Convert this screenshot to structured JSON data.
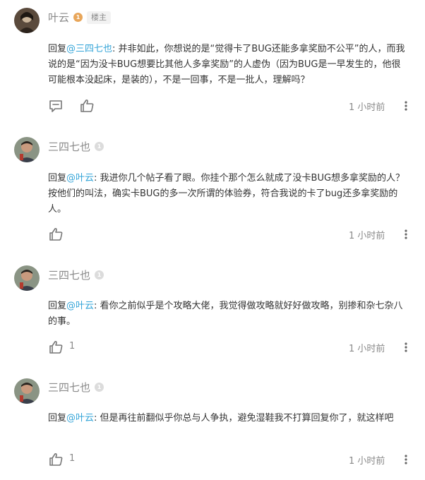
{
  "comments": [
    {
      "user": "叶云",
      "level_glyph": "1",
      "badge": "楼主",
      "reply_prefix": "回复",
      "reply_to": "@三四七也",
      "text": ": 并非如此，你想说的是“觉得卡了BUG还能多拿奖励不公平”的人，而我说的是“因为没卡BUG想要比其他人多拿奖励”的人虚伪（因为BUG是一早发生的，他很可能根本没起床，是装的），不是一回事，不是一批人，理解吗？",
      "likes": "",
      "time": "1 小时前",
      "icons": [
        "comment-icon",
        "thumbs-up-icon",
        "more-icon"
      ]
    },
    {
      "user": "三四七也",
      "level_glyph": "1",
      "reply_prefix": "回复",
      "reply_to": "@叶云",
      "text": ": 我进你几个帖子看了眼。你挂个那个怎么就成了没卡BUG想多拿奖励的人？按他们的叫法，确实卡BUG的多一次所谓的体验券，符合我说的卡了bug还多拿奖励的人。",
      "likes": "",
      "time": "1 小时前",
      "icons": [
        "thumbs-up-icon",
        "more-icon"
      ]
    },
    {
      "user": "三四七也",
      "level_glyph": "1",
      "reply_prefix": "回复",
      "reply_to": "@叶云",
      "text": ": 看你之前似乎是个攻略大佬，我觉得做攻略就好好做攻略，别掺和杂七杂八的事。",
      "likes": "1",
      "time": "1 小时前",
      "icons": [
        "thumbs-up-icon",
        "more-icon"
      ]
    },
    {
      "user": "三四七也",
      "level_glyph": "1",
      "reply_prefix": "回复",
      "reply_to": "@叶云",
      "text": ": 但是再往前翻似乎你总与人争执，避免湿鞋我不打算回复你了，就这样吧",
      "likes": "1",
      "time": "1 小时前",
      "icons": [
        "thumbs-up-icon",
        "more-icon"
      ]
    }
  ],
  "colors": {
    "mention": "#33a4d8",
    "muted": "#8a8a8a",
    "text": "#333333",
    "op_level": "#e8a65a"
  }
}
